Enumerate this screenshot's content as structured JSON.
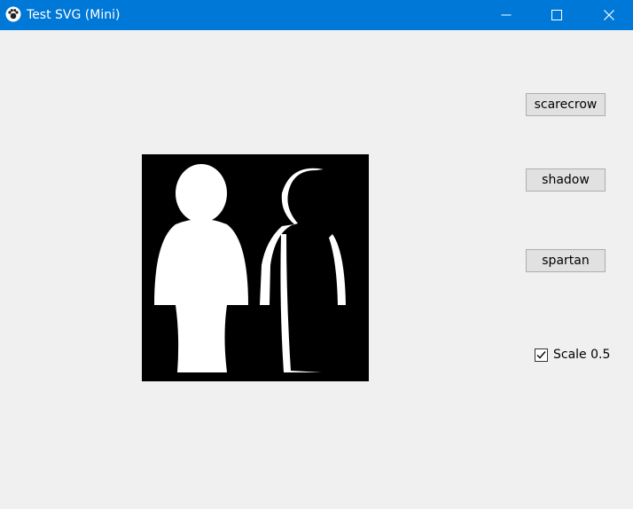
{
  "window": {
    "title": "Test SVG (Mini)",
    "accent_color": "#0078d7",
    "icon": "paw-icon",
    "controls": {
      "minimize_icon": "minimize-icon",
      "maximize_icon": "maximize-icon",
      "close_icon": "close-icon"
    }
  },
  "canvas": {
    "background": "#000000",
    "figure_color": "#ffffff",
    "content": [
      "scarecrow-figure",
      "shadow-figure"
    ]
  },
  "buttons": {
    "scarecrow": "scarecrow",
    "shadow": "shadow",
    "spartan": "spartan"
  },
  "scale_option": {
    "label": "Scale 0.5",
    "checked": true
  }
}
